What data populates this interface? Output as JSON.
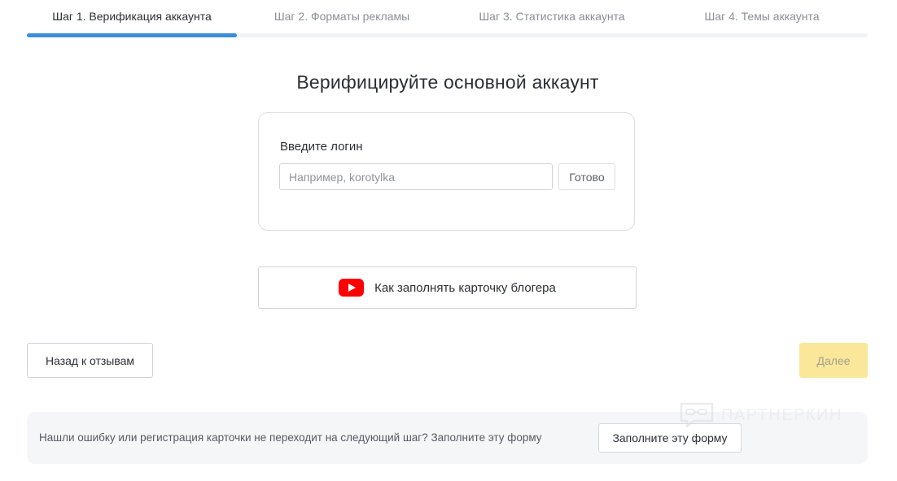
{
  "stepper": {
    "steps": [
      {
        "label": "Шаг 1. Верификация аккаунта",
        "active": true
      },
      {
        "label": "Шаг 2. Форматы рекламы",
        "active": false
      },
      {
        "label": "Шаг 3. Статистика аккаунта",
        "active": false
      },
      {
        "label": "Шаг 4. Темы аккаунта",
        "active": false
      }
    ],
    "progress_fraction": 0.25,
    "progress_color": "#3b8ddc"
  },
  "main": {
    "title": "Верифицируйте основной аккаунт",
    "login": {
      "label": "Введите логин",
      "value": "",
      "placeholder": "Например, korotylka",
      "submit_label": "Готово"
    },
    "video_help": {
      "icon": "youtube-icon",
      "icon_color": "#ff0000",
      "label": "Как заполнять карточку блогера"
    }
  },
  "navigation": {
    "back_label": "Назад к отзывам",
    "next_label": "Далее",
    "next_color": "#fae79a"
  },
  "notice": {
    "text": "Нашли ошибку или регистрация карточки не переходит на следующий шаг? Заполните эту форму",
    "button_label": "Заполните эту форму"
  },
  "watermark": {
    "text": "ПАРТНЕРКИН"
  }
}
